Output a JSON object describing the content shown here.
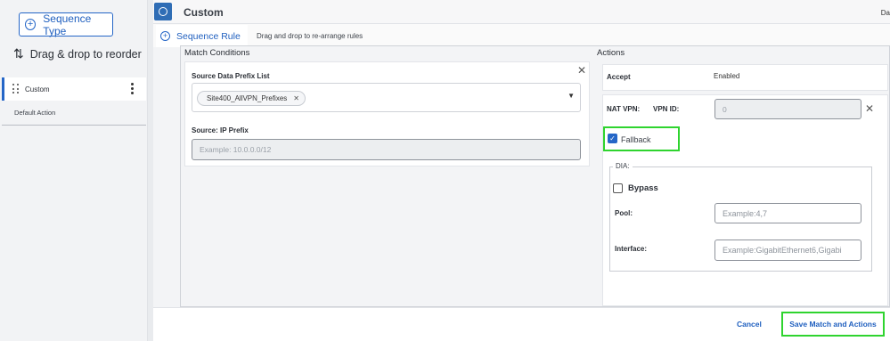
{
  "left_panel": {
    "sequence_type_button": "Sequence Type",
    "reorder_hint": "Drag & drop to reorder",
    "sequences": [
      {
        "label": "Custom"
      }
    ],
    "default_action": "Default Action"
  },
  "header": {
    "title": "Custom",
    "right_text": "Da"
  },
  "tabs": {
    "active_label": "Sequence Rule",
    "hint": "Drag and drop to re-arrange rules"
  },
  "match_conditions": {
    "title": "Match Conditions",
    "source_data_prefix_list": {
      "label": "Source Data Prefix List",
      "selected": [
        "Site400_AllVPN_Prefixes"
      ]
    },
    "source_ip_prefix": {
      "label": "Source: IP Prefix",
      "placeholder": "Example: 10.0.0.0/12"
    }
  },
  "actions": {
    "title": "Actions",
    "accept": {
      "label": "Accept",
      "status": "Enabled"
    },
    "nat_vpn": {
      "label": "NAT VPN:",
      "vpn_id_label": "VPN ID:",
      "vpn_id_value": "0"
    },
    "fallback": {
      "label": "Fallback",
      "checked": true
    },
    "dia": {
      "label": "DIA:",
      "bypass": {
        "label": "Bypass",
        "checked": false
      },
      "pool": {
        "label": "Pool:",
        "placeholder": "Example:4,7"
      },
      "interface": {
        "label": "Interface:",
        "placeholder": "Example:GigabitEthernet6,Gigabi"
      }
    }
  },
  "footer": {
    "cancel": "Cancel",
    "save": "Save Match and Actions"
  },
  "colors": {
    "accent": "#2566c7",
    "highlight": "#2fd42f"
  }
}
